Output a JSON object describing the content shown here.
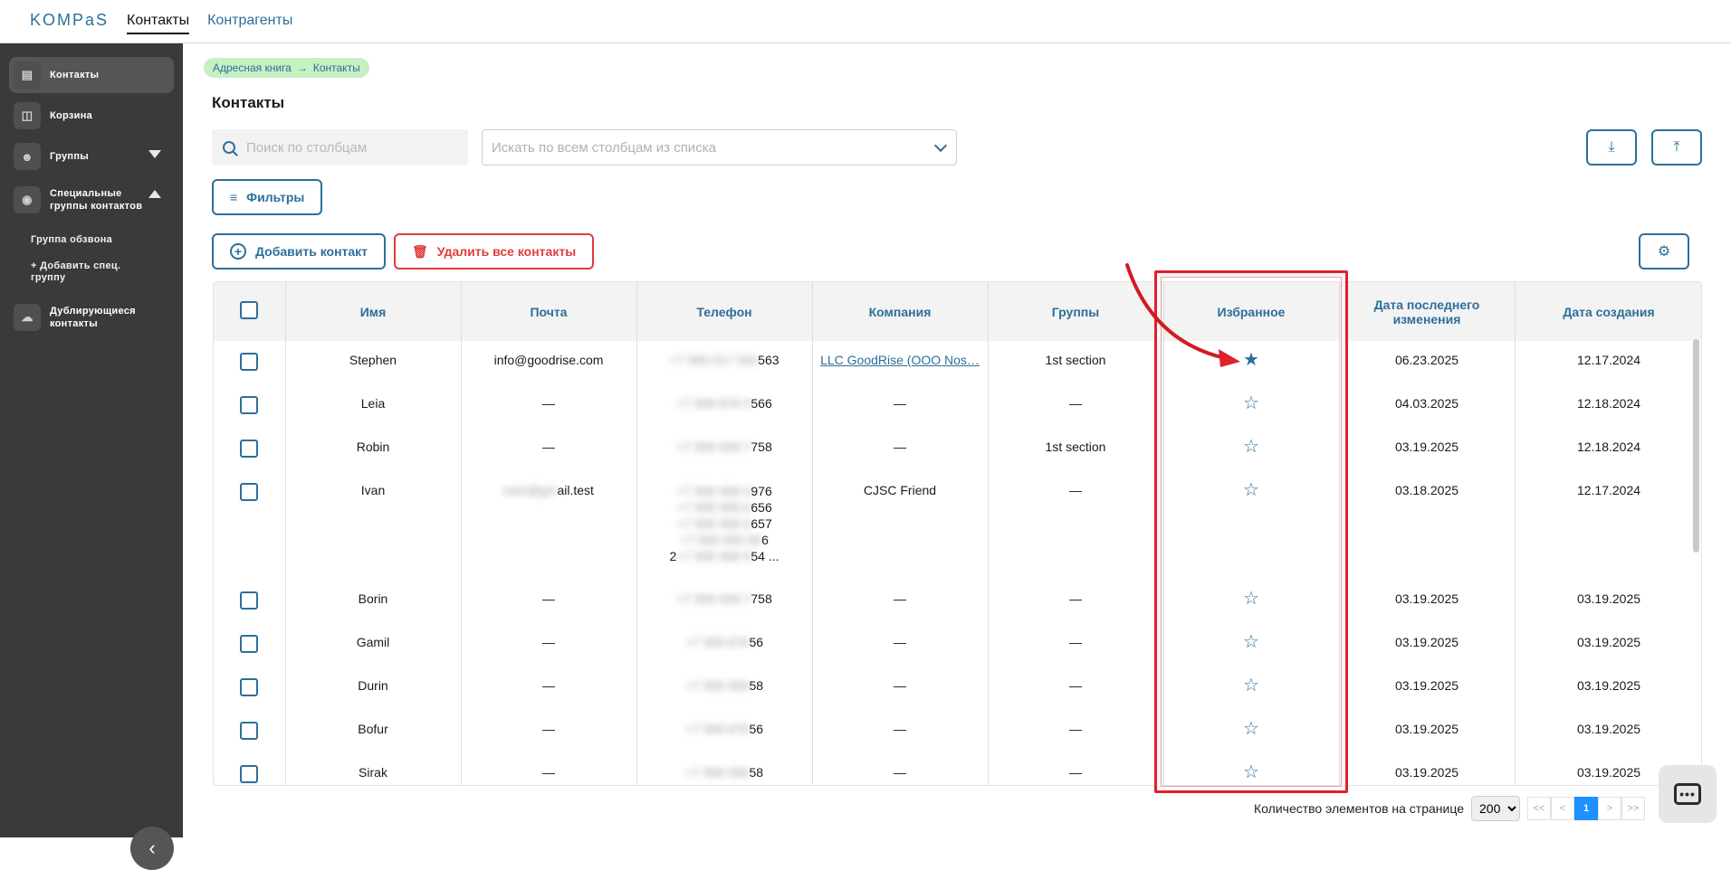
{
  "app": {
    "logo": "KOMPaS",
    "nav": [
      "Контакты",
      "Контрагенты"
    ]
  },
  "sidebar": {
    "items": [
      {
        "label": "Контакты",
        "icon": "contacts-icon"
      },
      {
        "label": "Корзина",
        "icon": "basket-icon"
      },
      {
        "label": "Группы",
        "icon": "users-icon"
      },
      {
        "label": "Специальные группы контактов",
        "icon": "eye-icon"
      },
      {
        "label": "Дублирующиеся контакты",
        "icon": "cloud-icon"
      }
    ],
    "sub_items": [
      "Группа обзвона",
      "+ Добавить спец. группу"
    ]
  },
  "breadcrumb": {
    "root": "Адресная книга",
    "current": "Контакты"
  },
  "page_title": "Контакты",
  "search": {
    "placeholder": "Поиск по столбцам"
  },
  "column_select": {
    "placeholder": "Искать по всем столбцам из списка"
  },
  "toolbar": {
    "filters_label": "Фильтры",
    "add_label": "Добавить контакт",
    "delete_all_label": "Удалить все контакты"
  },
  "table": {
    "columns": [
      "Имя",
      "Почта",
      "Телефон",
      "Компания",
      "Группы",
      "Избранное",
      "Дата последнего изменения",
      "Дата создания"
    ],
    "rows": [
      {
        "name": "Stephen",
        "email": "info@goodrise.com",
        "phone_hidden": "+7 999 917 563",
        "phone_tail": "563",
        "company": "LLC GoodRise (OOO Nos…",
        "company_link": true,
        "groups": "1st section",
        "favorite": true,
        "modified": "06.23.2025",
        "created": "12.17.2024"
      },
      {
        "name": "Leia",
        "email": "—",
        "phone_hidden": "+7 999 876 5",
        "phone_tail": "566",
        "company": "—",
        "company_link": false,
        "groups": "—",
        "favorite": false,
        "modified": "04.03.2025",
        "created": "12.18.2024"
      },
      {
        "name": "Robin",
        "email": "—",
        "phone_hidden": "+7 999 999 7",
        "phone_tail": "758",
        "company": "—",
        "company_link": false,
        "groups": "1st section",
        "favorite": false,
        "modified": "03.19.2025",
        "created": "12.18.2024"
      },
      {
        "name": "Ivan",
        "email": "—",
        "phone_hidden": "",
        "phone_tail": "",
        "company": "CJSC Friend",
        "company_link": false,
        "groups": "—",
        "favorite": false,
        "modified": "03.18.2025",
        "created": "12.17.2024"
      },
      {
        "name": "Borin",
        "email": "—",
        "phone_hidden": "+7 999 999 7",
        "phone_tail": "758",
        "company": "—",
        "company_link": false,
        "groups": "—",
        "favorite": false,
        "modified": "03.19.2025",
        "created": "03.19.2025"
      },
      {
        "name": "Gamil",
        "email": "—",
        "phone_hidden": "+7 999 876",
        "phone_tail": "56",
        "company": "—",
        "company_link": false,
        "groups": "—",
        "favorite": false,
        "modified": "03.19.2025",
        "created": "03.19.2025"
      },
      {
        "name": "Durin",
        "email": "—",
        "phone_hidden": "+7 999 999",
        "phone_tail": "58",
        "company": "—",
        "company_link": false,
        "groups": "—",
        "favorite": false,
        "modified": "03.19.2025",
        "created": "03.19.2025"
      },
      {
        "name": "Bofur",
        "email": "—",
        "phone_hidden": "+7 999 876",
        "phone_tail": "56",
        "company": "—",
        "company_link": false,
        "groups": "—",
        "favorite": false,
        "modified": "03.19.2025",
        "created": "03.19.2025"
      },
      {
        "name": "Sirak",
        "email": "—",
        "phone_hidden": "+7 999 999",
        "phone_tail": "58",
        "company": "—",
        "company_link": false,
        "groups": "—",
        "favorite": false,
        "modified": "03.19.2025",
        "created": "03.19.2025"
      }
    ],
    "ivan": {
      "email_hidden": "ivan@gm",
      "email_tail": "ail.test",
      "phones": [
        {
          "hidden": "+7 999 999 9",
          "tail": "976"
        },
        {
          "hidden": "+7 999 999 6",
          "tail": "656"
        },
        {
          "hidden": "+7 999 999 6",
          "tail": "657"
        },
        {
          "hidden": "+7 999 999 99",
          "tail": "6"
        },
        {
          "hidden": "+7 999 999 9",
          "tail": "54 ...",
          "lead": "2"
        }
      ]
    }
  },
  "pagination": {
    "label": "Количество элементов на странице",
    "page_size": "200",
    "first": "<<",
    "prev": "<",
    "current": "1",
    "next": ">",
    "last": ">>"
  },
  "colors": {
    "accent": "#2d6f9a",
    "danger": "#e23b3b",
    "sidebar": "#3a3a3a",
    "highlight": "#e0202a"
  }
}
